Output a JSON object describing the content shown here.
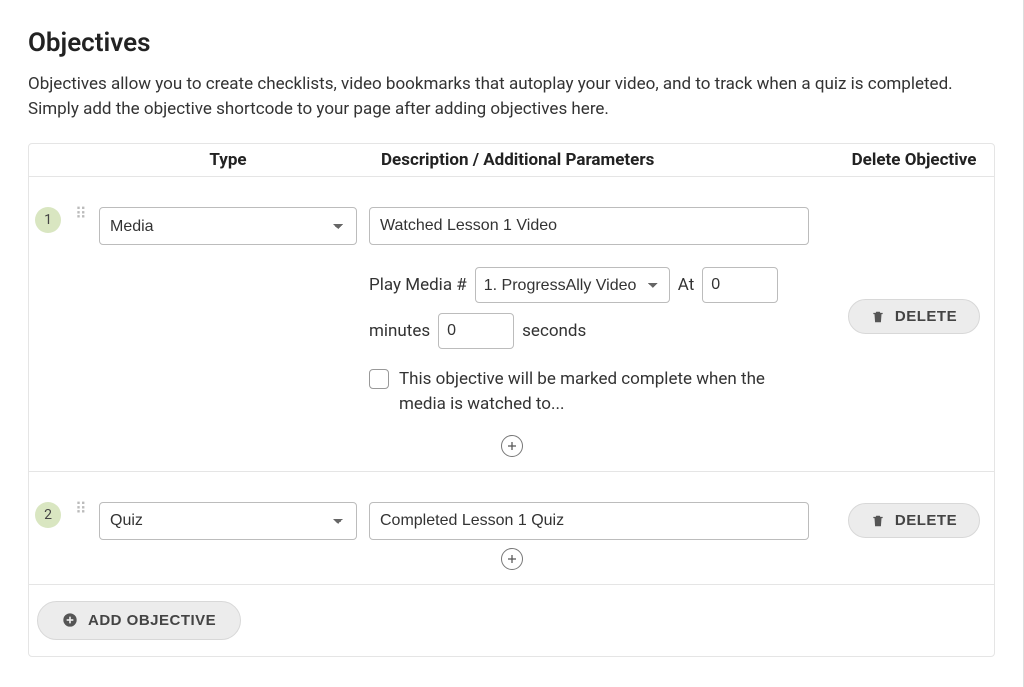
{
  "section": {
    "title": "Objectives",
    "description": "Objectives allow you to create checklists, video bookmarks that autoplay your video, and to track when a quiz is completed. Simply add the objective shortcode to your page after adding objectives here."
  },
  "table": {
    "headers": {
      "type": "Type",
      "desc": "Description / Additional Parameters",
      "delete": "Delete Objective"
    }
  },
  "labels": {
    "play_media": "Play Media #",
    "at": "At",
    "minutes": "minutes",
    "seconds": "seconds",
    "delete": "DELETE",
    "add_objective": "ADD OBJECTIVE"
  },
  "rows": [
    {
      "index": "1",
      "type": "Media",
      "description": "Watched Lesson 1 Video",
      "media_option": "1. ProgressAlly Video",
      "at_value": "0",
      "seconds_value": "0",
      "checkbox_label": "This objective will be marked complete when the media is watched to..."
    },
    {
      "index": "2",
      "type": "Quiz",
      "description": "Completed Lesson 1 Quiz"
    }
  ]
}
